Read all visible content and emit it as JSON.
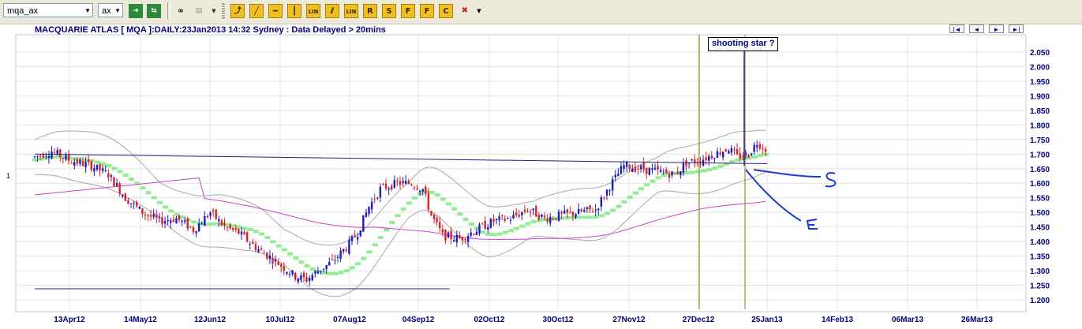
{
  "toolbar": {
    "symbol_value": "mqa_ax",
    "exchange_value": "ax",
    "buttons": [
      {
        "label": "",
        "icon": "go-arrow-icon",
        "color": "#2a8a3a"
      },
      {
        "label": "",
        "icon": "refresh-icon",
        "color": "#2a8a3a"
      },
      {
        "label": "",
        "icon": "binoculars-icon",
        "color": "#333333"
      },
      {
        "label": "",
        "icon": "compare-icon",
        "color": "#999999"
      }
    ],
    "draw_tools": [
      {
        "label": "",
        "icon": "cursor-draw-icon"
      },
      {
        "label": "",
        "icon": "trendline-icon"
      },
      {
        "label": "",
        "icon": "horizontal-line-icon"
      },
      {
        "label": "",
        "icon": "vertical-line-icon"
      },
      {
        "label": "LIN",
        "icon": "linear-regression-icon"
      },
      {
        "label": "",
        "icon": "parallel-lines-icon"
      },
      {
        "label": "LIN",
        "icon": "linear-channel-icon"
      },
      {
        "label": "R",
        "icon": "r-tool-icon"
      },
      {
        "label": "S",
        "icon": "s-tool-icon"
      },
      {
        "label": "F",
        "icon": "fib-icon"
      },
      {
        "label": "F",
        "icon": "fib-arc-icon"
      },
      {
        "label": "C",
        "icon": "cycle-icon"
      },
      {
        "label": "✖",
        "icon": "delete-icon"
      }
    ]
  },
  "chart": {
    "title": "MACQUARIE ATLAS [ MQA ]:DAILY:23Jan2013 14:32 Sydney : Data Delayed > 20mins",
    "annotation": "shooting star ?",
    "left_marker": "1",
    "nav": [
      "|◄",
      "◄",
      "►",
      "►|"
    ]
  },
  "chart_data": {
    "type": "candlestick",
    "title": "MACQUARIE ATLAS [ MQA ]:DAILY:23Jan2013 14:32 Sydney : Data Delayed > 20mins",
    "ylim": [
      1.17,
      2.08
    ],
    "yticks": [
      "2.050",
      "2.000",
      "1.950",
      "1.900",
      "1.850",
      "1.800",
      "1.750",
      "1.700",
      "1.650",
      "1.600",
      "1.550",
      "1.500",
      "1.450",
      "1.400",
      "1.350",
      "1.300",
      "1.250",
      "1.200"
    ],
    "ytick_values": [
      2.05,
      2.0,
      1.95,
      1.9,
      1.85,
      1.8,
      1.75,
      1.7,
      1.65,
      1.6,
      1.55,
      1.5,
      1.45,
      1.4,
      1.35,
      1.3,
      1.25,
      1.2
    ],
    "xticks": [
      "13Apr12",
      "14May12",
      "12Jun12",
      "10Jul12",
      "07Aug12",
      "04Sep12",
      "02Oct12",
      "30Oct12",
      "27Nov12",
      "27Dec12",
      "25Jan13",
      "14Feb13",
      "06Mar13",
      "26Mar13"
    ],
    "grid": true,
    "colors": {
      "up": "#1a1ad0",
      "down": "#e02020",
      "bollinger": "#a8a8a8",
      "moving_average": "#d040d0",
      "green_band": "#90ee90",
      "trendline": "#1a237e",
      "vline": "#8b7a00",
      "handwriting": "#1a3ad8"
    },
    "price_path": [
      [
        0,
        1.69
      ],
      [
        6,
        1.71
      ],
      [
        12,
        1.68
      ],
      [
        20,
        1.66
      ],
      [
        26,
        1.63
      ],
      [
        32,
        1.55
      ],
      [
        38,
        1.5
      ],
      [
        44,
        1.47
      ],
      [
        50,
        1.48
      ],
      [
        56,
        1.44
      ],
      [
        62,
        1.5
      ],
      [
        67,
        1.45
      ],
      [
        72,
        1.43
      ],
      [
        78,
        1.38
      ],
      [
        84,
        1.34
      ],
      [
        88,
        1.31
      ],
      [
        92,
        1.28
      ],
      [
        96,
        1.27
      ],
      [
        100,
        1.3
      ],
      [
        105,
        1.33
      ],
      [
        110,
        1.38
      ],
      [
        114,
        1.43
      ],
      [
        118,
        1.52
      ],
      [
        122,
        1.58
      ],
      [
        128,
        1.6
      ],
      [
        133,
        1.6
      ],
      [
        137,
        1.58
      ],
      [
        140,
        1.49
      ],
      [
        144,
        1.42
      ],
      [
        150,
        1.41
      ],
      [
        156,
        1.44
      ],
      [
        162,
        1.47
      ],
      [
        168,
        1.48
      ],
      [
        174,
        1.51
      ],
      [
        180,
        1.48
      ],
      [
        186,
        1.49
      ],
      [
        192,
        1.5
      ],
      [
        198,
        1.51
      ],
      [
        203,
        1.59
      ],
      [
        208,
        1.66
      ],
      [
        214,
        1.65
      ],
      [
        220,
        1.64
      ],
      [
        226,
        1.63
      ],
      [
        230,
        1.67
      ],
      [
        235,
        1.68
      ],
      [
        240,
        1.7
      ],
      [
        245,
        1.72
      ],
      [
        248,
        1.69
      ],
      [
        252,
        1.7
      ],
      [
        255,
        1.74
      ],
      [
        258,
        1.72
      ]
    ],
    "annotations": [
      "shooting star ?"
    ]
  }
}
